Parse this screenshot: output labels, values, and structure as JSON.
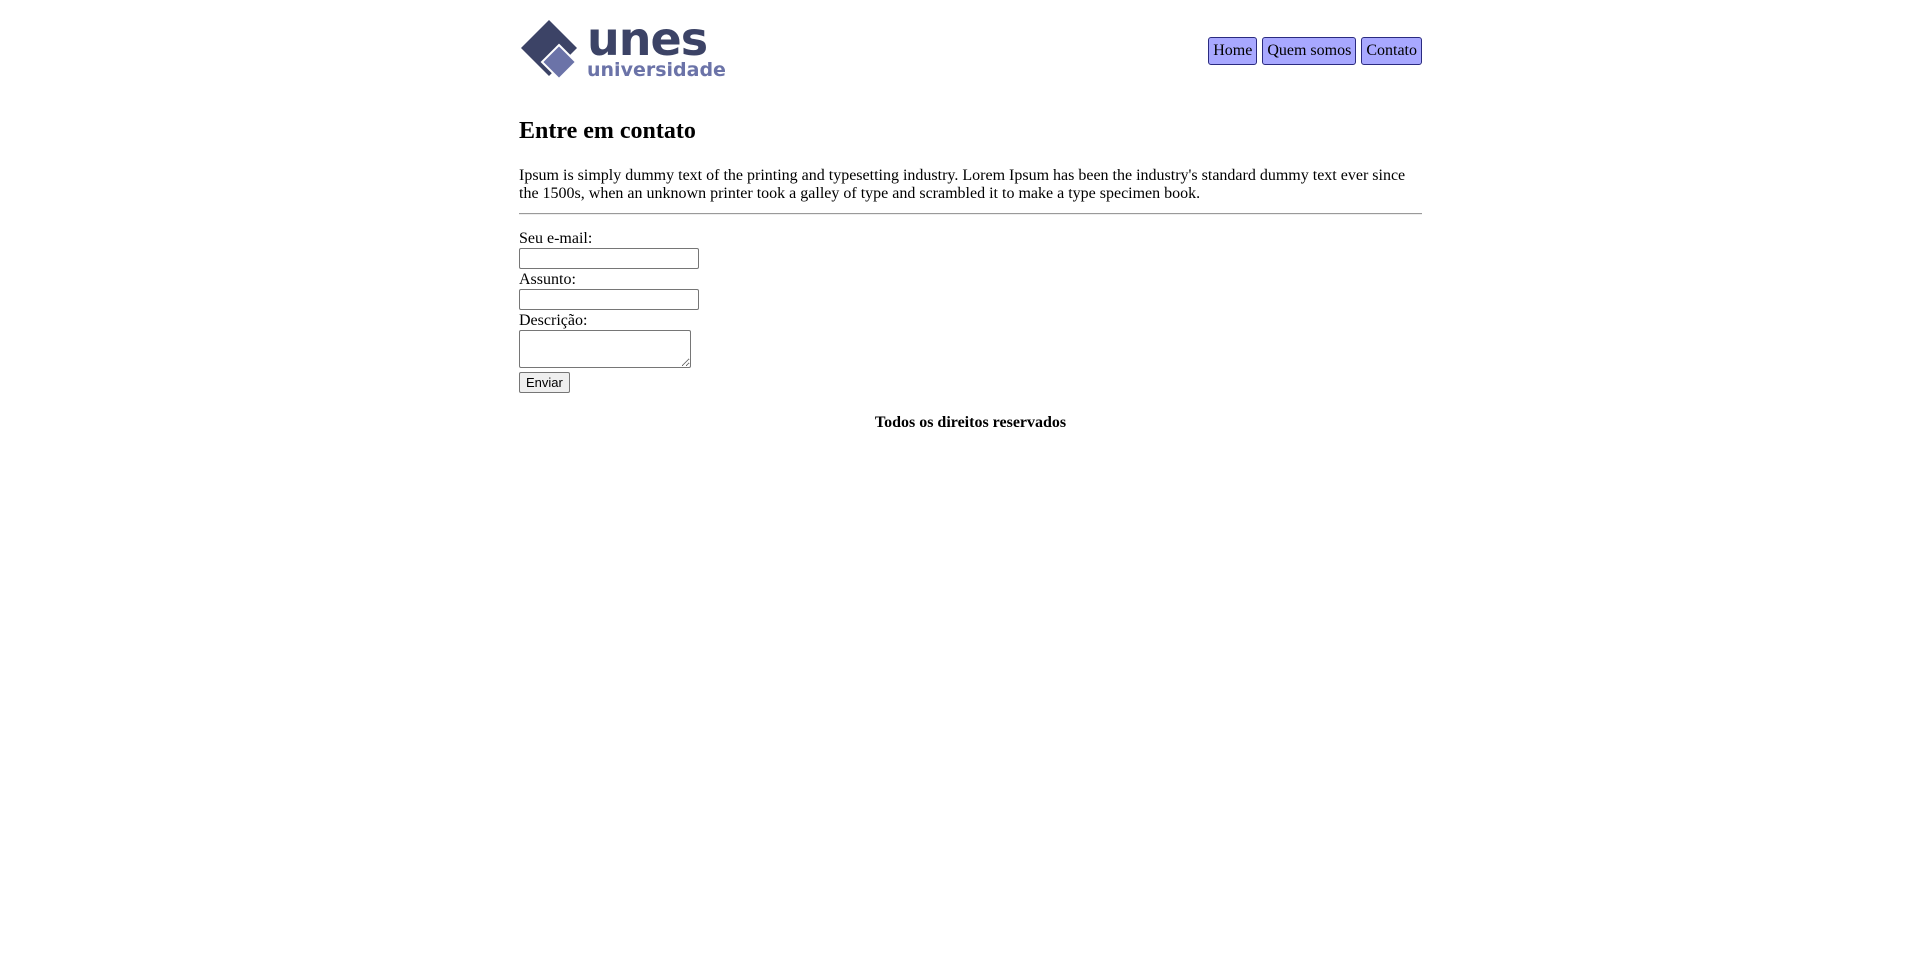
{
  "header": {
    "logo": {
      "name": "unes",
      "subtitle": "universidade",
      "colors": {
        "dark": "#3c4366",
        "light": "#6b73a8"
      }
    },
    "nav": [
      {
        "label": "Home"
      },
      {
        "label": "Quem somos"
      },
      {
        "label": "Contato"
      }
    ]
  },
  "main": {
    "title": "Entre em contato",
    "intro": "Ipsum is simply dummy text of the printing and typesetting industry. Lorem Ipsum has been the industry's standard dummy text ever since the 1500s, when an unknown printer took a galley of type and scrambled it to make a type specimen book.",
    "form": {
      "email_label": "Seu e-mail:",
      "email_value": "",
      "subject_label": "Assunto:",
      "subject_value": "",
      "description_label": "Descrição:",
      "description_value": "",
      "submit_label": "Enviar"
    }
  },
  "footer": {
    "text": "Todos os direitos reservados"
  },
  "colors": {
    "nav_bg": "#a8a8ff",
    "nav_border": "#2b2b80"
  }
}
